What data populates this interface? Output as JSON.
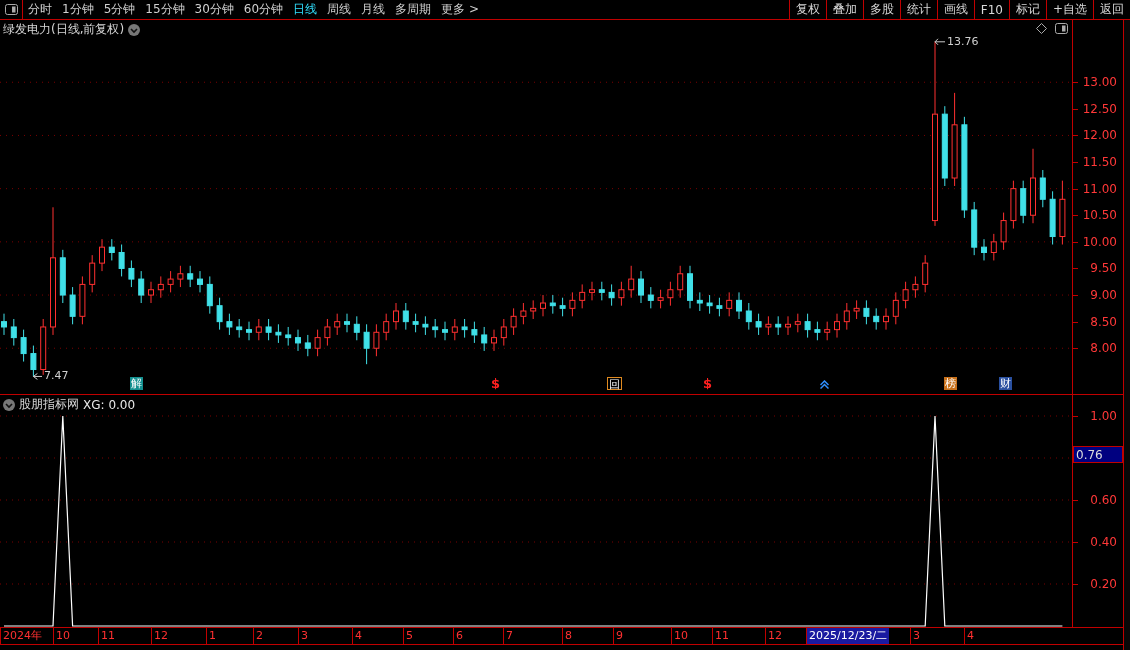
{
  "toolbar": {
    "periods": [
      {
        "label": "分时",
        "selected": false
      },
      {
        "label": "1分钟",
        "selected": false
      },
      {
        "label": "5分钟",
        "selected": false
      },
      {
        "label": "15分钟",
        "selected": false
      },
      {
        "label": "30分钟",
        "selected": false
      },
      {
        "label": "60分钟",
        "selected": false
      },
      {
        "label": "日线",
        "selected": true
      },
      {
        "label": "周线",
        "selected": false
      },
      {
        "label": "月线",
        "selected": false
      },
      {
        "label": "多周期",
        "selected": false
      },
      {
        "label": "更多 >",
        "selected": false
      }
    ],
    "actions": [
      "复权",
      "叠加",
      "多股",
      "统计",
      "画线",
      "F10",
      "标记",
      "+自选",
      "返回"
    ]
  },
  "price_chart": {
    "title": "绿发电力(日线,前复权)",
    "low_label": "7.47",
    "high_label": "13.76",
    "events": [
      {
        "kind": "box",
        "text": "解",
        "color": "#138f8f"
      },
      {
        "kind": "glyph",
        "text": "$",
        "color": "#ff2020"
      },
      {
        "kind": "outline",
        "text": "回",
        "color": "#e08a20"
      },
      {
        "kind": "glyph",
        "text": "$",
        "color": "#ff2020"
      },
      {
        "kind": "arrow",
        "color": "#2f8fff"
      },
      {
        "kind": "box",
        "text": "榜",
        "color": "#c8701a"
      },
      {
        "kind": "box",
        "text": "财",
        "color": "#2a50a0"
      }
    ],
    "chart_data": {
      "type": "candlestick",
      "ylim": [
        7.14,
        14.17
      ],
      "grid": true,
      "yticks": [
        {
          "value": 8,
          "label": "8.00"
        },
        {
          "value": 8.5,
          "label": "8.50"
        },
        {
          "value": 9,
          "label": "9.00"
        },
        {
          "value": 9.5,
          "label": "9.50"
        },
        {
          "value": 10,
          "label": "10.00"
        },
        {
          "value": 10.5,
          "label": "10.50"
        },
        {
          "value": 11,
          "label": "11.00"
        },
        {
          "value": 11.5,
          "label": "11.50"
        },
        {
          "value": 12,
          "label": "12.00"
        },
        {
          "value": 12.5,
          "label": "12.50"
        },
        {
          "value": 13,
          "label": "13.00"
        }
      ],
      "ohlc": [
        [
          8.5,
          8.65,
          8.25,
          8.4
        ],
        [
          8.4,
          8.55,
          8.05,
          8.2
        ],
        [
          8.2,
          8.35,
          7.75,
          7.9
        ],
        [
          7.9,
          8.05,
          7.47,
          7.6
        ],
        [
          7.6,
          8.55,
          7.5,
          8.4
        ],
        [
          8.4,
          10.65,
          8.25,
          9.7
        ],
        [
          9.7,
          9.85,
          8.85,
          9.0
        ],
        [
          9.0,
          9.15,
          8.45,
          8.6
        ],
        [
          8.6,
          9.35,
          8.45,
          9.2
        ],
        [
          9.2,
          9.75,
          9.05,
          9.6
        ],
        [
          9.6,
          10.05,
          9.45,
          9.9
        ],
        [
          9.9,
          10.05,
          9.65,
          9.8
        ],
        [
          9.8,
          9.95,
          9.35,
          9.5
        ],
        [
          9.5,
          9.65,
          9.15,
          9.3
        ],
        [
          9.3,
          9.45,
          8.85,
          9.0
        ],
        [
          9.0,
          9.25,
          8.85,
          9.1
        ],
        [
          9.1,
          9.35,
          8.95,
          9.2
        ],
        [
          9.2,
          9.45,
          9.05,
          9.3
        ],
        [
          9.3,
          9.55,
          9.15,
          9.4
        ],
        [
          9.4,
          9.55,
          9.15,
          9.3
        ],
        [
          9.3,
          9.45,
          9.05,
          9.2
        ],
        [
          9.2,
          9.35,
          8.65,
          8.8
        ],
        [
          8.8,
          8.95,
          8.35,
          8.5
        ],
        [
          8.5,
          8.65,
          8.25,
          8.4
        ],
        [
          8.4,
          8.55,
          8.2,
          8.35
        ],
        [
          8.35,
          8.5,
          8.15,
          8.3
        ],
        [
          8.3,
          8.55,
          8.15,
          8.4
        ],
        [
          8.4,
          8.55,
          8.15,
          8.3
        ],
        [
          8.3,
          8.45,
          8.1,
          8.25
        ],
        [
          8.25,
          8.4,
          8.05,
          8.2
        ],
        [
          8.2,
          8.35,
          7.95,
          8.1
        ],
        [
          8.1,
          8.25,
          7.85,
          8.0
        ],
        [
          8.0,
          8.35,
          7.85,
          8.2
        ],
        [
          8.2,
          8.55,
          8.05,
          8.4
        ],
        [
          8.4,
          8.65,
          8.25,
          8.5
        ],
        [
          8.5,
          8.65,
          8.3,
          8.45
        ],
        [
          8.45,
          8.6,
          8.15,
          8.3
        ],
        [
          8.3,
          8.45,
          7.7,
          8.0
        ],
        [
          8.0,
          8.45,
          7.85,
          8.3
        ],
        [
          8.3,
          8.65,
          8.15,
          8.5
        ],
        [
          8.5,
          8.85,
          8.35,
          8.7
        ],
        [
          8.7,
          8.85,
          8.35,
          8.5
        ],
        [
          8.5,
          8.65,
          8.3,
          8.45
        ],
        [
          8.45,
          8.6,
          8.25,
          8.4
        ],
        [
          8.4,
          8.55,
          8.2,
          8.35
        ],
        [
          8.35,
          8.5,
          8.15,
          8.3
        ],
        [
          8.3,
          8.55,
          8.15,
          8.4
        ],
        [
          8.4,
          8.55,
          8.2,
          8.35
        ],
        [
          8.35,
          8.5,
          8.1,
          8.25
        ],
        [
          8.25,
          8.4,
          7.95,
          8.1
        ],
        [
          8.1,
          8.35,
          7.95,
          8.2
        ],
        [
          8.2,
          8.55,
          8.05,
          8.4
        ],
        [
          8.4,
          8.75,
          8.25,
          8.6
        ],
        [
          8.6,
          8.85,
          8.45,
          8.7
        ],
        [
          8.7,
          8.9,
          8.55,
          8.75
        ],
        [
          8.75,
          9.0,
          8.6,
          8.85
        ],
        [
          8.85,
          9.0,
          8.65,
          8.8
        ],
        [
          8.8,
          8.95,
          8.6,
          8.75
        ],
        [
          8.75,
          9.05,
          8.6,
          8.9
        ],
        [
          8.9,
          9.2,
          8.75,
          9.05
        ],
        [
          9.05,
          9.25,
          8.9,
          9.1
        ],
        [
          9.1,
          9.25,
          8.9,
          9.05
        ],
        [
          9.05,
          9.2,
          8.8,
          8.95
        ],
        [
          8.95,
          9.25,
          8.8,
          9.1
        ],
        [
          9.1,
          9.55,
          8.95,
          9.3
        ],
        [
          9.3,
          9.45,
          8.85,
          9.0
        ],
        [
          9.0,
          9.15,
          8.75,
          8.9
        ],
        [
          8.9,
          9.1,
          8.75,
          8.95
        ],
        [
          8.95,
          9.25,
          8.8,
          9.1
        ],
        [
          9.1,
          9.55,
          8.95,
          9.4
        ],
        [
          9.4,
          9.55,
          8.75,
          8.9
        ],
        [
          8.9,
          9.05,
          8.7,
          8.85
        ],
        [
          8.85,
          9.0,
          8.65,
          8.8
        ],
        [
          8.8,
          8.95,
          8.6,
          8.75
        ],
        [
          8.75,
          9.05,
          8.6,
          8.9
        ],
        [
          8.9,
          9.05,
          8.55,
          8.7
        ],
        [
          8.7,
          8.85,
          8.35,
          8.5
        ],
        [
          8.5,
          8.65,
          8.25,
          8.4
        ],
        [
          8.4,
          8.6,
          8.25,
          8.45
        ],
        [
          8.45,
          8.6,
          8.25,
          8.4
        ],
        [
          8.4,
          8.6,
          8.25,
          8.45
        ],
        [
          8.45,
          8.65,
          8.3,
          8.5
        ],
        [
          8.5,
          8.65,
          8.2,
          8.35
        ],
        [
          8.35,
          8.5,
          8.15,
          8.3
        ],
        [
          8.3,
          8.5,
          8.15,
          8.35
        ],
        [
          8.35,
          8.65,
          8.2,
          8.5
        ],
        [
          8.5,
          8.85,
          8.35,
          8.7
        ],
        [
          8.7,
          8.9,
          8.55,
          8.75
        ],
        [
          8.75,
          8.9,
          8.45,
          8.6
        ],
        [
          8.6,
          8.75,
          8.35,
          8.5
        ],
        [
          8.5,
          8.75,
          8.35,
          8.6
        ],
        [
          8.6,
          9.05,
          8.45,
          8.9
        ],
        [
          8.9,
          9.25,
          8.75,
          9.1
        ],
        [
          9.1,
          9.35,
          8.95,
          9.2
        ],
        [
          9.2,
          9.75,
          9.05,
          9.6
        ],
        [
          10.4,
          13.76,
          10.3,
          12.4
        ],
        [
          12.4,
          12.55,
          11.05,
          11.2
        ],
        [
          11.2,
          12.8,
          11.05,
          12.2
        ],
        [
          12.2,
          12.35,
          10.45,
          10.6
        ],
        [
          10.6,
          10.75,
          9.75,
          9.9
        ],
        [
          9.9,
          10.05,
          9.65,
          9.8
        ],
        [
          9.8,
          10.15,
          9.65,
          10.0
        ],
        [
          10.0,
          10.55,
          9.85,
          10.4
        ],
        [
          10.4,
          11.15,
          10.25,
          11.0
        ],
        [
          11.0,
          11.15,
          10.35,
          10.5
        ],
        [
          10.5,
          11.75,
          10.35,
          11.2
        ],
        [
          11.2,
          11.35,
          10.65,
          10.8
        ],
        [
          10.8,
          10.95,
          9.95,
          10.1
        ],
        [
          10.1,
          11.15,
          9.95,
          10.8
        ]
      ]
    }
  },
  "indicator": {
    "title": "股朋指标网",
    "reading": "XG: 0.00",
    "current": "0.76",
    "chart_data": {
      "type": "line",
      "ylim": [
        0,
        1.1
      ],
      "grid": true,
      "yticks": [
        {
          "value": 0.2,
          "label": "0.20"
        },
        {
          "value": 0.4,
          "label": "0.40"
        },
        {
          "value": 0.6,
          "label": "0.60"
        },
        {
          "value": 1,
          "label": "1.00"
        }
      ],
      "series": [
        {
          "color": "#ffffff",
          "values": [
            0,
            0,
            0,
            0,
            0,
            0,
            1,
            0,
            0,
            0,
            0,
            0,
            0,
            0,
            0,
            0,
            0,
            0,
            0,
            0,
            0,
            0,
            0,
            0,
            0,
            0,
            0,
            0,
            0,
            0,
            0,
            0,
            0,
            0,
            0,
            0,
            0,
            0,
            0,
            0,
            0,
            0,
            0,
            0,
            0,
            0,
            0,
            0,
            0,
            0,
            0,
            0,
            0,
            0,
            0,
            0,
            0,
            0,
            0,
            0,
            0,
            0,
            0,
            0,
            0,
            0,
            0,
            0,
            0,
            0,
            0,
            0,
            0,
            0,
            0,
            0,
            0,
            0,
            0,
            0,
            0,
            0,
            0,
            0,
            0,
            0,
            0,
            0,
            0,
            0,
            0,
            0,
            0,
            0,
            0,
            1,
            0,
            0,
            0,
            0,
            0,
            0,
            0,
            0,
            0,
            0,
            0,
            0,
            0
          ]
        }
      ]
    }
  },
  "date_axis": [
    {
      "label": "2024年",
      "selected": false
    },
    {
      "label": "10",
      "selected": false
    },
    {
      "label": "11",
      "selected": false
    },
    {
      "label": "12",
      "selected": false
    },
    {
      "label": "1",
      "selected": false
    },
    {
      "label": "2",
      "selected": false
    },
    {
      "label": "3",
      "selected": false
    },
    {
      "label": "4",
      "selected": false
    },
    {
      "label": "5",
      "selected": false
    },
    {
      "label": "6",
      "selected": false
    },
    {
      "label": "7",
      "selected": false
    },
    {
      "label": "8",
      "selected": false
    },
    {
      "label": "9",
      "selected": false
    },
    {
      "label": "10",
      "selected": false
    },
    {
      "label": "11",
      "selected": false
    },
    {
      "label": "12",
      "selected": false
    },
    {
      "label": "2025/12/23/二",
      "selected": true
    },
    {
      "label": "3",
      "selected": false
    },
    {
      "label": "4",
      "selected": false
    }
  ]
}
